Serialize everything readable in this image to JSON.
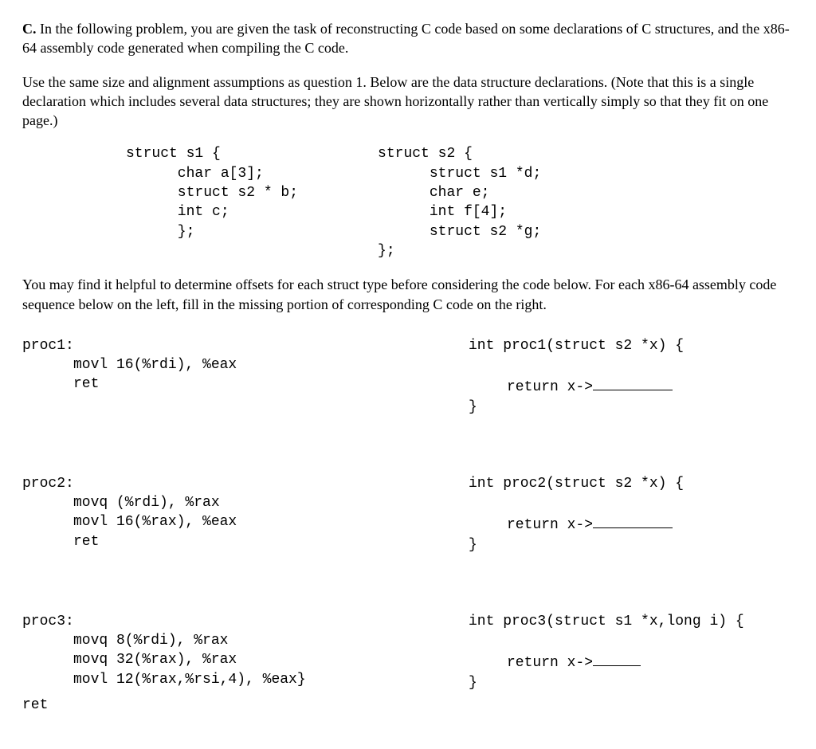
{
  "intro": {
    "marker": "C.",
    "text1a": " In the following problem, you are given the task of reconstructing C code based on some declarations of C structures, and the x86-64 assembly code generated when compiling the C code.",
    "text2": "Use the same size and alignment assumptions as question 1. Below are the data structure declarations. (Note that this is a single declaration which includes several data structures; they are shown horizontally rather than vertically simply so that they fit on one page.)"
  },
  "structs": {
    "s1": "struct s1 {\n      char a[3];\n      struct s2 * b;\n      int c;\n      };",
    "s2": "struct s2 {\n      struct s1 *d;\n      char e;\n      int f[4];\n      struct s2 *g;\n};"
  },
  "mid_text": "You may find it helpful to determine offsets for each struct type before considering the code below. For each x86-64 assembly code sequence below on the left, fill in the missing portion of corresponding C code on the right.",
  "proc1": {
    "label": "proc1:",
    "asm": "movl 16(%rdi), %eax\nret",
    "c_sig": "int proc1(struct s2 *x) {",
    "c_return_prefix": "return x->",
    "c_close": "}"
  },
  "proc2": {
    "label": "proc2:",
    "asm": "movq (%rdi), %rax\nmovl 16(%rax), %eax\nret",
    "c_sig": "int proc2(struct s2 *x) {",
    "c_return_prefix": "return x->",
    "c_close": "}"
  },
  "proc3": {
    "label": "proc3:",
    "asm": "movq 8(%rdi), %rax\nmovq 32(%rax), %rax\nmovl 12(%rax,%rsi,4), %eax}",
    "c_sig": "int proc3(struct s1 *x,long i) {",
    "c_return_prefix": "return x->",
    "c_close": "}",
    "ret": "ret"
  }
}
